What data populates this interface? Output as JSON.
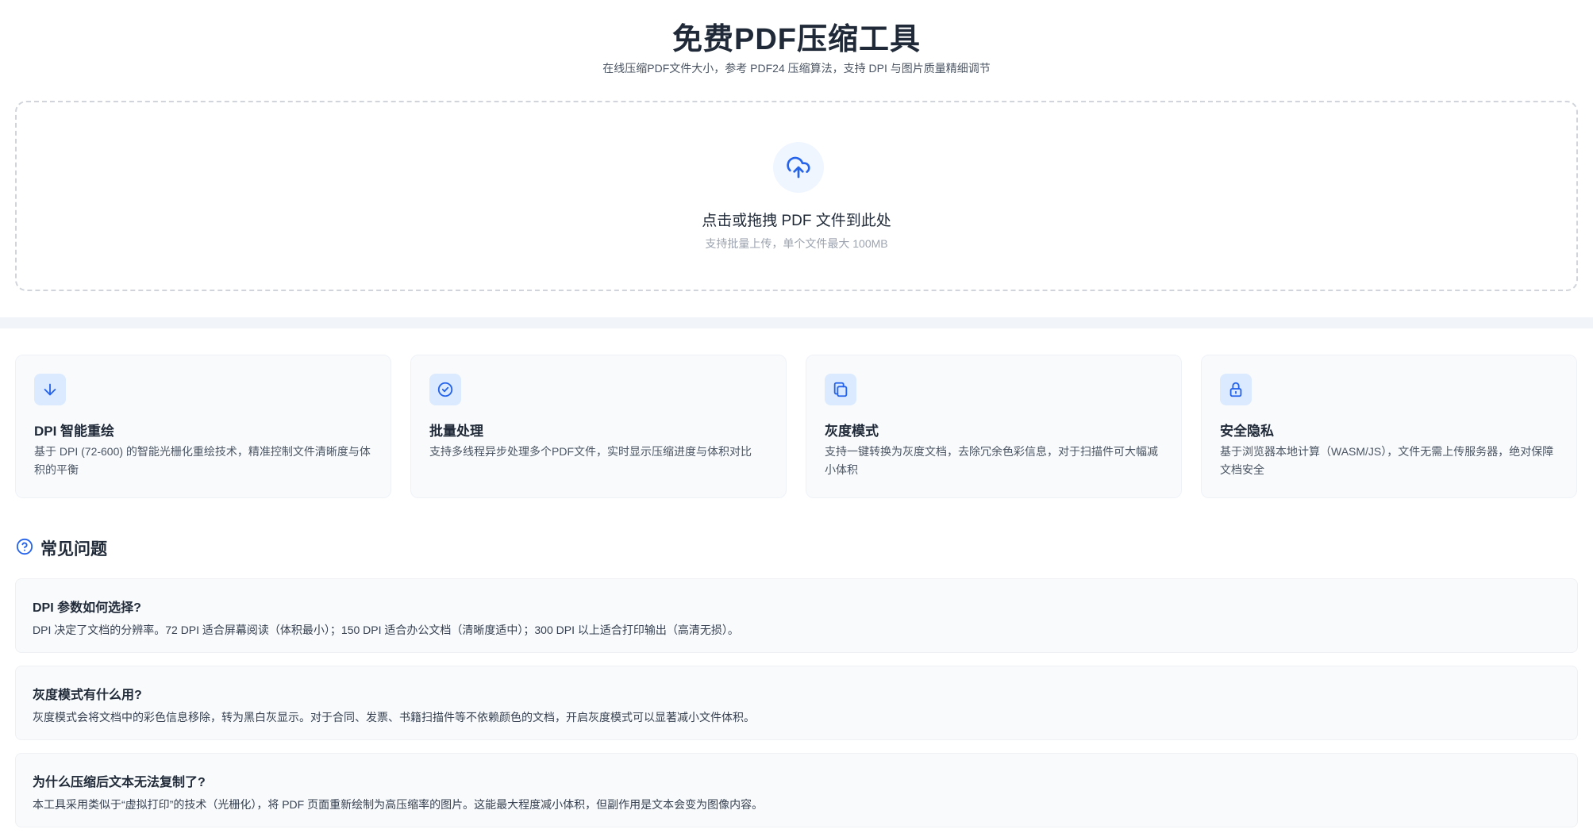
{
  "header": {
    "title": "免费PDF压缩工具",
    "subtitle": "在线压缩PDF文件大小，参考 PDF24 压缩算法，支持 DPI 与图片质量精细调节"
  },
  "upload": {
    "icon": "cloud-upload-icon",
    "title": "点击或拖拽 PDF 文件到此处",
    "hint": "支持批量上传，单个文件最大 100MB"
  },
  "features": [
    {
      "icon": "arrow-down-icon",
      "title": "DPI 智能重绘",
      "desc": "基于 DPI (72-600) 的智能光栅化重绘技术，精准控制文件清晰度与体积的平衡"
    },
    {
      "icon": "check-circle-icon",
      "title": "批量处理",
      "desc": "支持多线程异步处理多个PDF文件，实时显示压缩进度与体积对比"
    },
    {
      "icon": "copy-icon",
      "title": "灰度模式",
      "desc": "支持一键转换为灰度文档，去除冗余色彩信息，对于扫描件可大幅减小体积"
    },
    {
      "icon": "lock-icon",
      "title": "安全隐私",
      "desc": "基于浏览器本地计算（WASM/JS），文件无需上传服务器，绝对保障文档安全"
    }
  ],
  "faq": {
    "icon": "help-circle-icon",
    "heading": "常见问题",
    "items": [
      {
        "question": "DPI 参数如何选择?",
        "answer": "DPI 决定了文档的分辨率。72 DPI 适合屏幕阅读（体积最小）；150 DPI 适合办公文档（清晰度适中）；300 DPI 以上适合打印输出（高清无损）。"
      },
      {
        "question": "灰度模式有什么用?",
        "answer": "灰度模式会将文档中的彩色信息移除，转为黑白灰显示。对于合同、发票、书籍扫描件等不依赖颜色的文档，开启灰度模式可以显著减小文件体积。"
      },
      {
        "question": "为什么压缩后文本无法复制了?",
        "answer": "本工具采用类似于“虚拟打印”的技术（光栅化），将 PDF 页面重新绘制为高压缩率的图片。这能最大程度减小体积，但副作用是文本会变为图像内容。"
      }
    ]
  },
  "colors": {
    "accent": "#2563eb",
    "icon_bg": "#dbeafe",
    "card_bg": "#f8fafc"
  }
}
